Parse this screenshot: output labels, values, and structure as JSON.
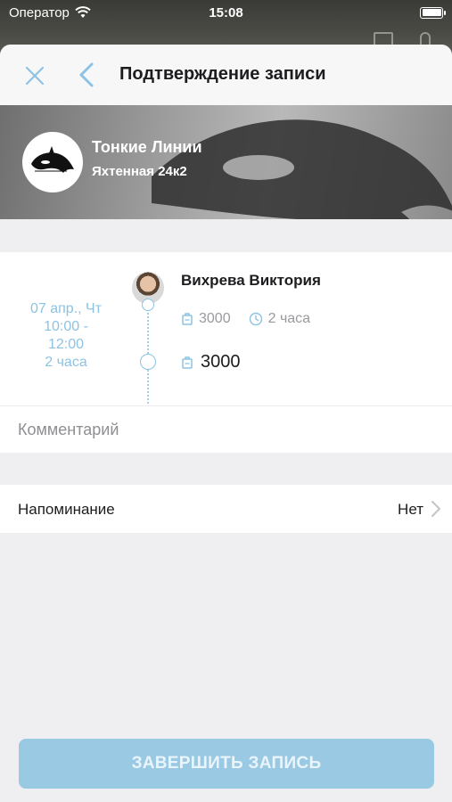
{
  "status_bar": {
    "carrier": "Оператор",
    "time": "15:08"
  },
  "nav": {
    "title": "Подтверждение записи"
  },
  "salon": {
    "name": "Тонкие Линии",
    "address": "Яхтенная 24к2"
  },
  "booking": {
    "date": "07 апр., Чт",
    "time_start": "10:00 -",
    "time_end": "12:00",
    "duration": "2 часа",
    "master_name": "Вихрева Виктория",
    "service_price": "3000",
    "service_duration": "2 часа",
    "total": "3000"
  },
  "comment": {
    "placeholder": "Комментарий"
  },
  "reminder": {
    "label": "Напоминание",
    "value": "Нет"
  },
  "finish_button": {
    "label": "ЗАВЕРШИТЬ ЗАПИСЬ"
  },
  "colors": {
    "accent": "#8cc3e3",
    "button": "#9ac9e4",
    "background": "#efeff1"
  },
  "icons": [
    "wifi-icon",
    "battery-icon",
    "close-icon",
    "back-chevron-icon",
    "orca-logo",
    "price-tag-icon",
    "clock-icon",
    "chevron-right-icon"
  ]
}
